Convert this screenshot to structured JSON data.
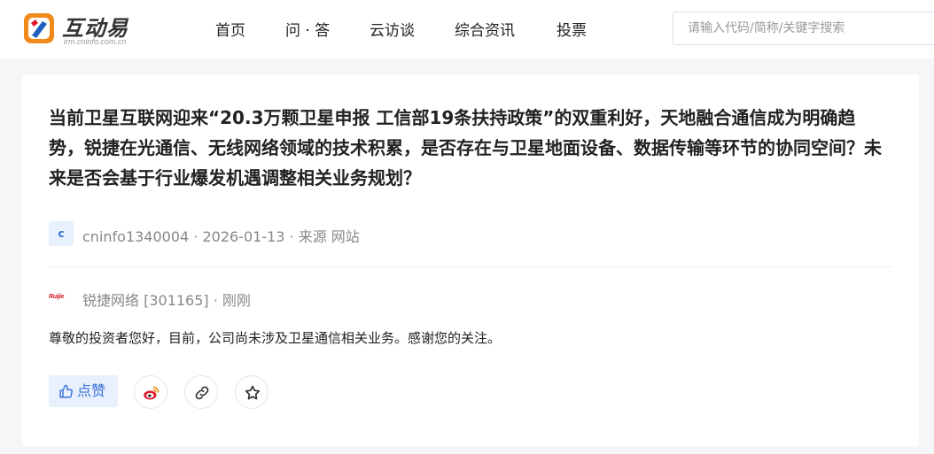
{
  "header": {
    "logo_text": "互动易",
    "logo_sub": "irm.cninfo.com.cn",
    "nav": [
      "首页",
      "问 · 答",
      "云访谈",
      "综合资讯",
      "投票"
    ],
    "search_placeholder": "请输入代码/简称/关键字搜索"
  },
  "question": {
    "text": "当前卫星互联网迎来“20.3万颗卫星申报 工信部19条扶持政策”的双重利好，天地融合通信成为明确趋势，锐捷在光通信、无线网络领域的技术积累，是否存在与卫星地面设备、数据传输等环节的协同空间？未来是否会基于行业爆发机遇调整相关业务规划？",
    "avatar_letter": "c",
    "meta": "cninfo1340004 · 2026-01-13 · 来源 网站"
  },
  "answer": {
    "company_logo_text": "Ruijie",
    "meta": "锐捷网络 [301165] · 刚刚",
    "text": "尊敬的投资者您好，目前，公司尚未涉及卫星通信相关业务。感谢您的关注。"
  },
  "actions": {
    "like_label": "点赞"
  },
  "colors": {
    "accent": "#3a70d8",
    "weibo": "#e6162d",
    "brand_orange": "#f08a1c"
  }
}
